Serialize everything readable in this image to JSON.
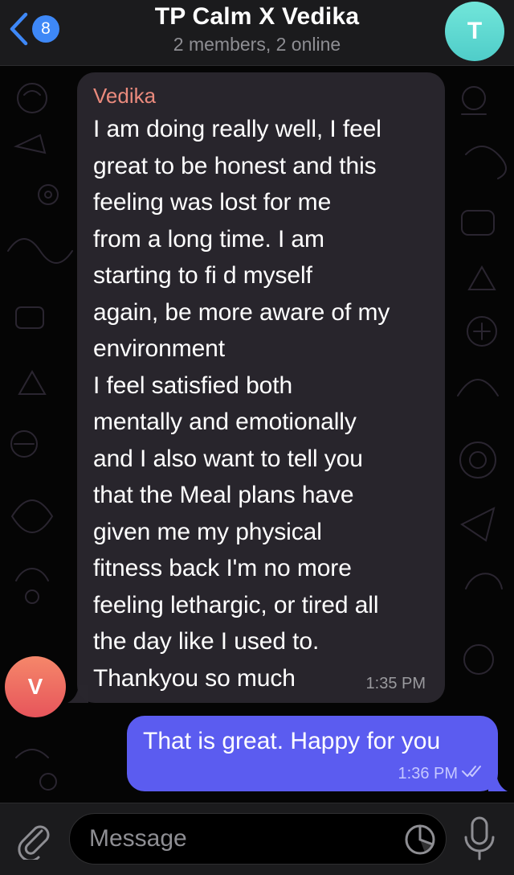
{
  "header": {
    "back_badge": "8",
    "title": "TP Calm X Vedika",
    "subtitle": "2 members, 2 online",
    "avatar_letter": "T",
    "avatar_color": "#5ed6d0"
  },
  "messages": [
    {
      "direction": "incoming",
      "sender": "Vedika",
      "sender_color": "#ea8a7d",
      "avatar_letter": "V",
      "avatar_color": "#ee6a60",
      "text": "I am doing really well, I feel\ngreat to be honest and this\nfeeling was lost for me\nfrom a long time. I am\nstarting to fi d myself\nagain, be more aware of my\nenvironment\nI feel satisfied both\nmentally and emotionally\nand I also want to tell you\nthat the Meal plans have\ngiven me my physical\nfitness back I'm no more\nfeeling lethargic, or tired all\nthe day like I used to.\nThankyou so much",
      "time": "1:35 PM"
    },
    {
      "direction": "outgoing",
      "text": "That is great. Happy for you",
      "time": "1:36 PM",
      "status": "read",
      "bubble_color": "#5b5cf0"
    }
  ],
  "input": {
    "placeholder": "Message"
  },
  "icons": {
    "back": "chevron-left-icon",
    "attach": "paperclip-icon",
    "sticker": "sticker-icon",
    "mic": "microphone-icon",
    "read_status": "double-check-icon"
  },
  "colors": {
    "accent": "#3e88f7",
    "outgoing_bubble": "#5b5cf0",
    "incoming_bubble": "#2a262e"
  }
}
